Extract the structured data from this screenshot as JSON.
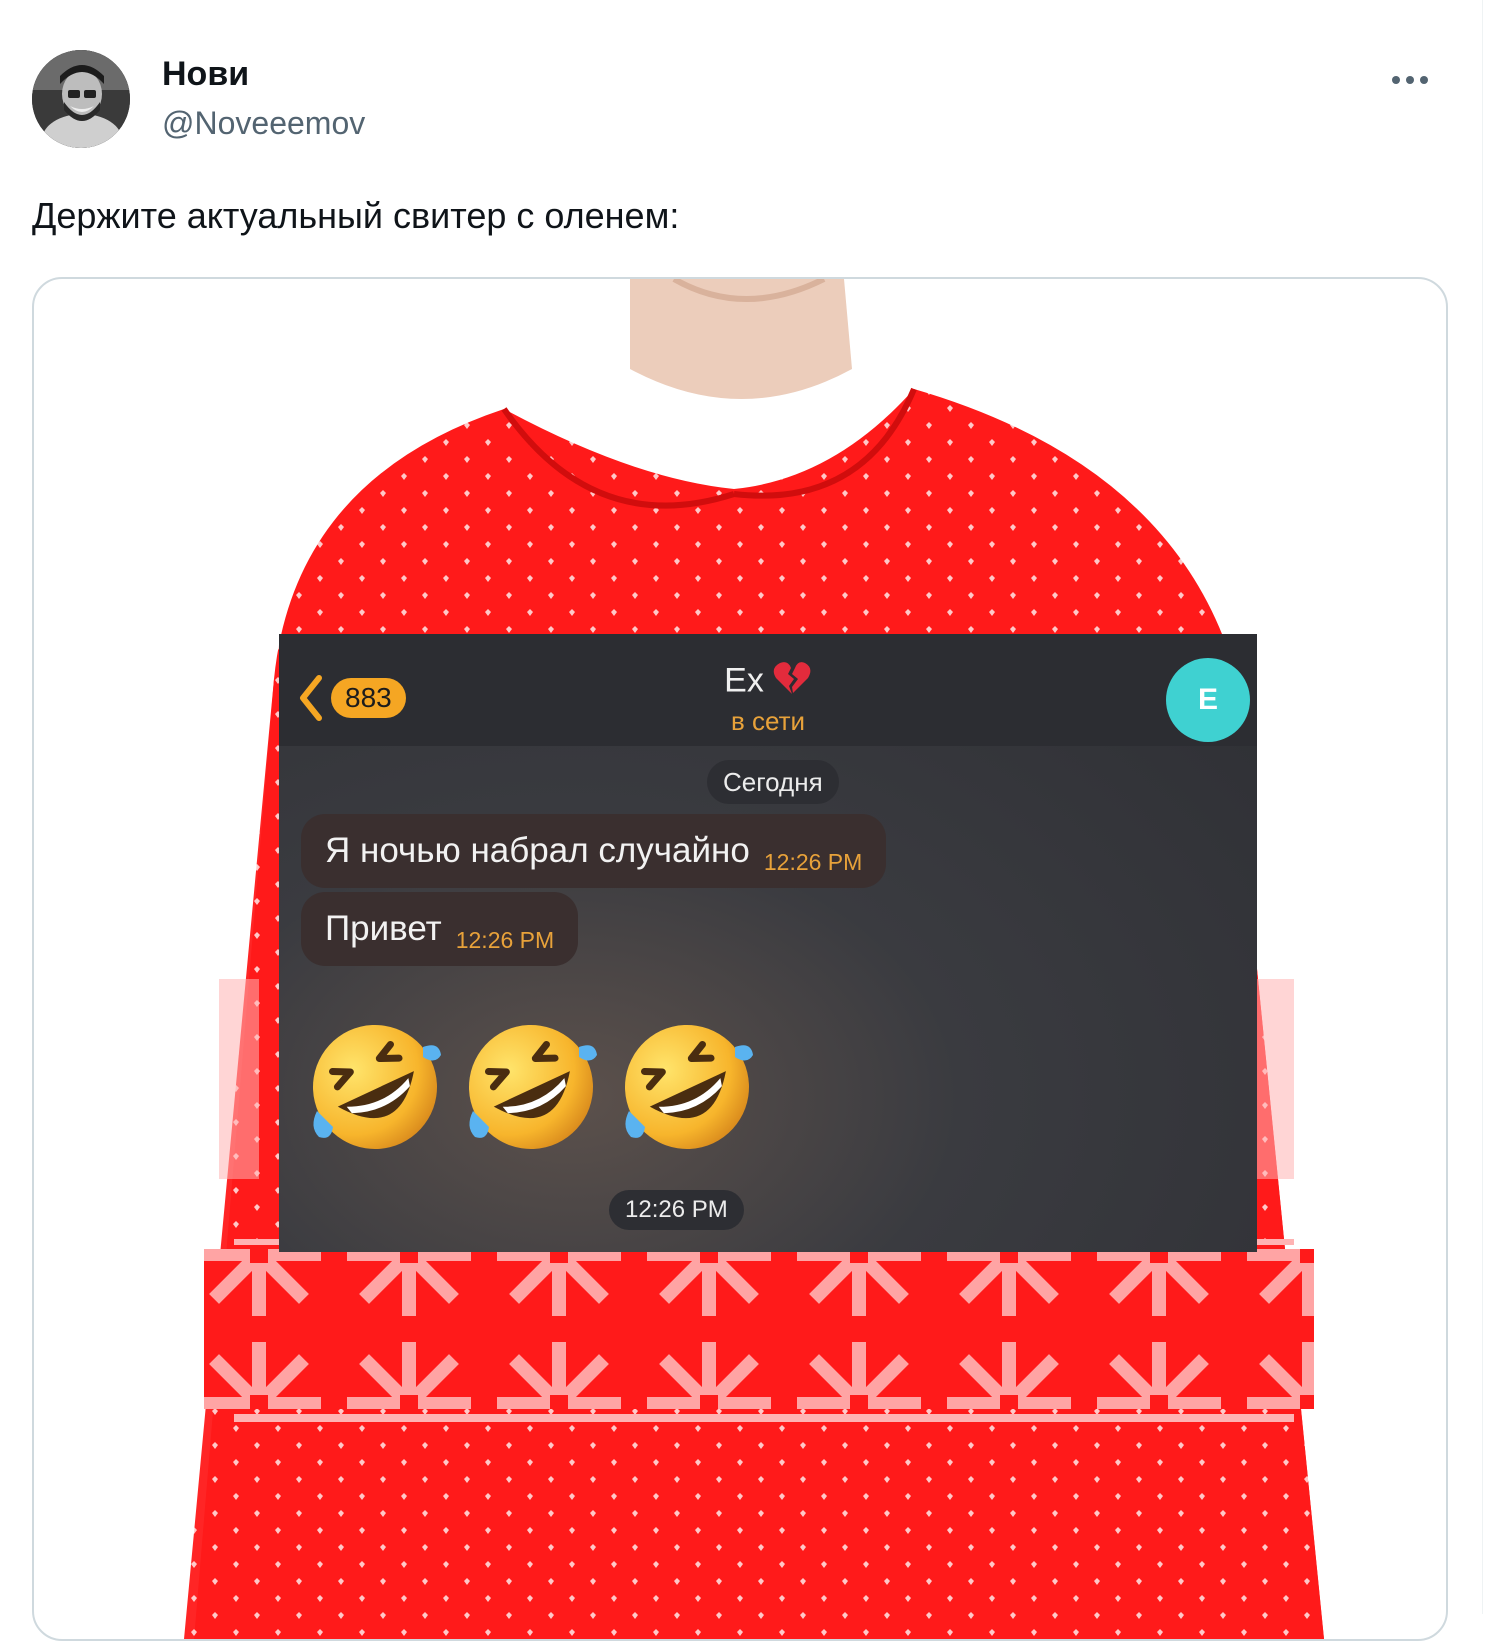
{
  "tweet": {
    "author_name": "Нови",
    "author_handle": "@Noveeemov",
    "text": "Держите актуальный свитер с оленем:",
    "more_icon": "more-horizontal-icon"
  },
  "chat": {
    "unread_count": "883",
    "contact_name": "Ex",
    "contact_emoji": "broken-heart-icon",
    "status": "в сети",
    "contact_avatar_letter": "E",
    "date_label": "Сегодня",
    "messages": [
      {
        "text": "Я ночью набрал случайно",
        "time": "12:26 PM"
      },
      {
        "text": "Привет",
        "time": "12:26 PM"
      }
    ],
    "emoji_message": {
      "emojis": [
        "rolling-on-floor-laughing-icon",
        "rolling-on-floor-laughing-icon",
        "rolling-on-floor-laughing-icon"
      ],
      "time": "12:26 PM"
    }
  },
  "colors": {
    "accent": "#f5a623",
    "sweater": "#ff1a1a",
    "avatar_teal": "#3fd1d1"
  }
}
